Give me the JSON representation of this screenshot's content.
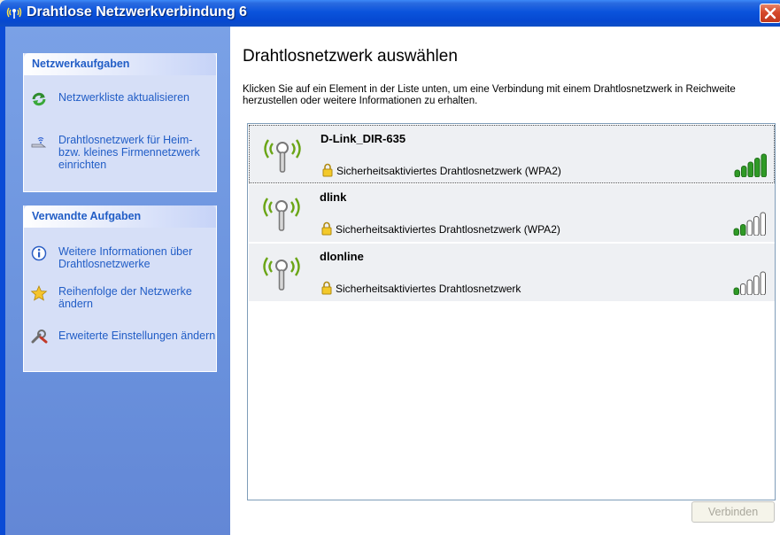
{
  "window": {
    "title": "Drahtlose Netzwerkverbindung 6"
  },
  "sidebar": {
    "network_tasks": {
      "header": "Netzwerkaufgaben",
      "items": [
        {
          "label": "Netzwerkliste aktualisieren",
          "icon": "refresh-icon"
        },
        {
          "label": "Drahtlosnetzwerk für Heim- bzw. kleines Firmennetzwerk einrichten",
          "icon": "wizard-icon"
        }
      ]
    },
    "related_tasks": {
      "header": "Verwandte Aufgaben",
      "items": [
        {
          "label": "Weitere Informationen über Drahtlosnetzwerke",
          "icon": "info-icon"
        },
        {
          "label": "Reihenfolge der Netzwerke ändern",
          "icon": "star-icon"
        },
        {
          "label": "Erweiterte Einstellungen ändern",
          "icon": "settings-icon"
        }
      ]
    }
  },
  "main": {
    "title": "Drahtlosnetzwerk auswählen",
    "description": "Klicken Sie auf ein Element in der Liste unten, um eine Verbindung mit einem Drahtlosnetzwerk in Reichweite herzustellen oder weitere Informationen zu erhalten.",
    "networks": [
      {
        "ssid": "D-Link_DIR-635",
        "security": "Sicherheitsaktiviertes Drahtlosnetzwerk (WPA2)",
        "signal_bars": 5,
        "selected": true
      },
      {
        "ssid": "dlink",
        "security": "Sicherheitsaktiviertes Drahtlosnetzwerk (WPA2)",
        "signal_bars": 2,
        "selected": false
      },
      {
        "ssid": "dlonline",
        "security": "Sicherheitsaktiviertes Drahtlosnetzwerk",
        "signal_bars": 1,
        "selected": false
      }
    ],
    "connect_label": "Verbinden"
  },
  "colors": {
    "title_bar": "#0a53dc",
    "task_link": "#215dc6",
    "signal_on": "#2f9a26",
    "signal_off": "#c8c8c8"
  }
}
